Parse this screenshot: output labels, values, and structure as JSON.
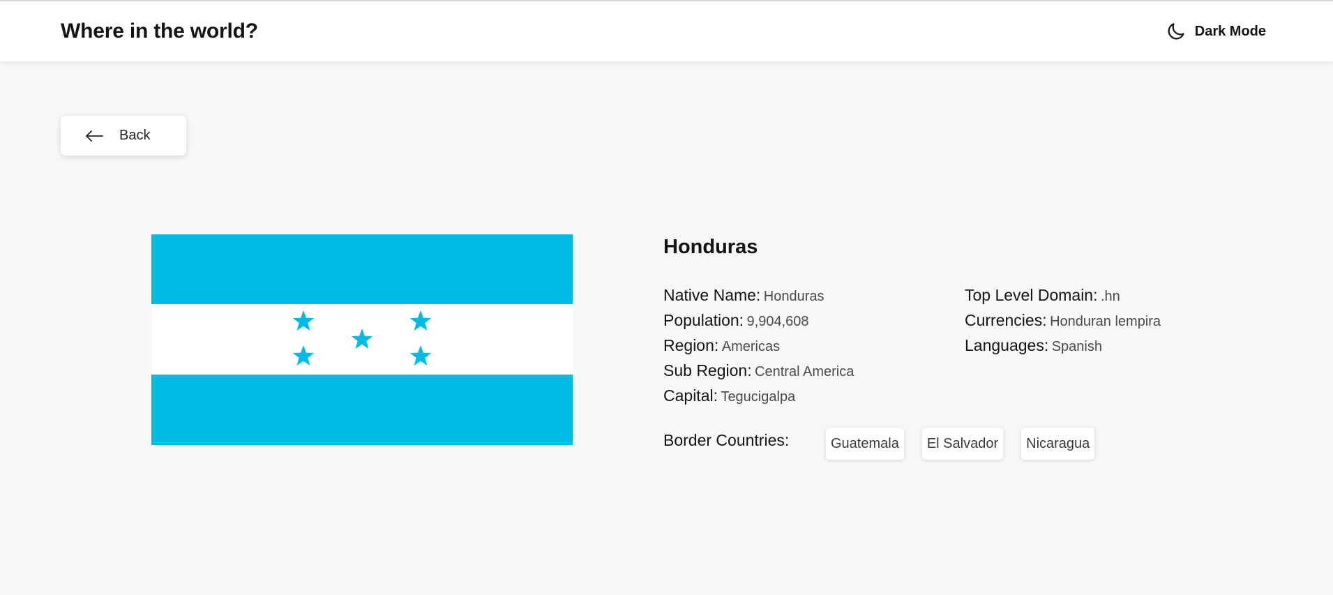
{
  "header": {
    "title": "Where in the world?",
    "mode_label": "Dark Mode",
    "mode_icon": "moon-icon"
  },
  "back_button": {
    "label": "Back",
    "icon": "arrow-left-icon"
  },
  "flag": {
    "colors": {
      "stripe": "#00bce4",
      "band": "#ffffff"
    }
  },
  "country": {
    "name": "Honduras",
    "fields_left": [
      {
        "label": "Native Name:",
        "value": "Honduras"
      },
      {
        "label": "Population:",
        "value": "9,904,608"
      },
      {
        "label": "Region:",
        "value": "Americas"
      },
      {
        "label": "Sub Region:",
        "value": "Central America"
      },
      {
        "label": "Capital:",
        "value": "Tegucigalpa"
      }
    ],
    "fields_right": [
      {
        "label": "Top Level Domain:",
        "value": ".hn"
      },
      {
        "label": "Currencies:",
        "value": "Honduran lempira"
      },
      {
        "label": "Languages:",
        "value": "Spanish"
      }
    ],
    "border_label": "Border Countries:",
    "borders": [
      "Guatemala",
      "El Salvador",
      "Nicaragua"
    ]
  }
}
